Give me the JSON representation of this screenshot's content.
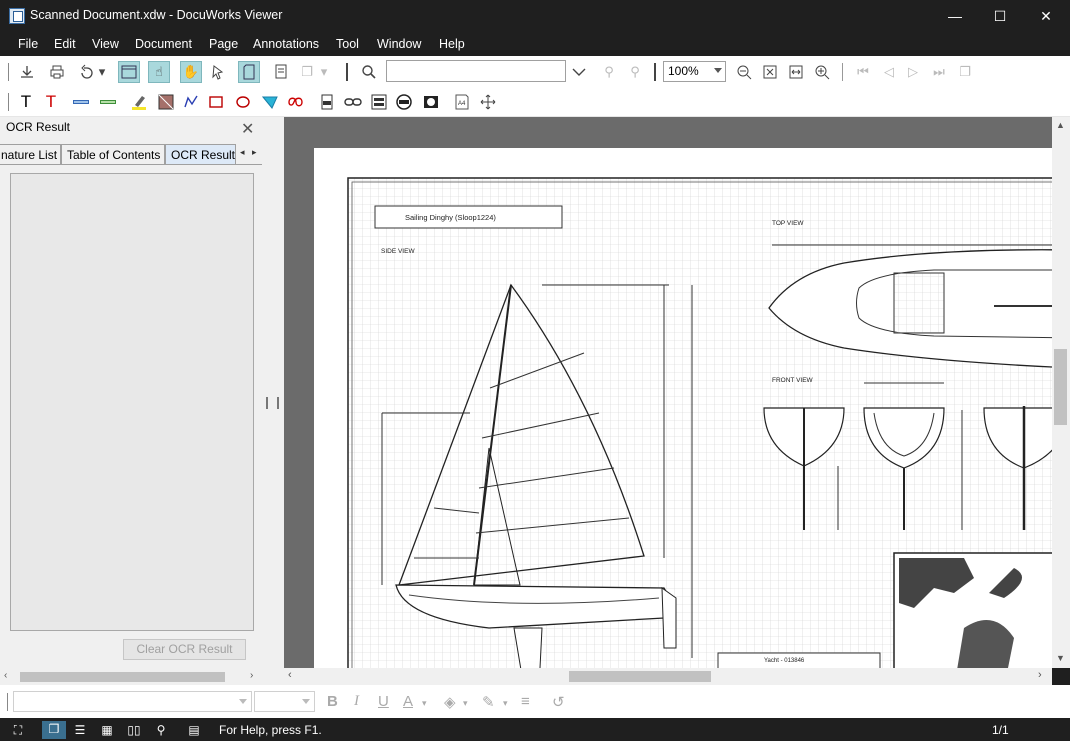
{
  "window": {
    "title": "Scanned Document.xdw - DocuWorks Viewer",
    "controls": {
      "minimize": "—",
      "maximize": "☐",
      "close": "✕"
    }
  },
  "menu": [
    "File",
    "Edit",
    "View",
    "Document",
    "Page",
    "Annotations",
    "Tool",
    "Window",
    "Help"
  ],
  "toolbar": {
    "search": {
      "value": "",
      "placeholder": ""
    },
    "zoom": "100%"
  },
  "panel": {
    "title": "OCR Result",
    "tabs": [
      "nature List",
      "Table of Contents",
      "OCR Result"
    ],
    "active_tab": "OCR Result",
    "clear_button": "Clear OCR Result"
  },
  "document": {
    "blueprint_title": "Sailing Dinghy (Sloop1224)",
    "side_view_label": "SIDE VIEW",
    "top_view_label": "TOP VIEW",
    "front_view_label": "FRONT VIEW",
    "footer_label": "Yacht - 013846"
  },
  "status": {
    "help_text": "For Help, press F1.",
    "page": "1/1"
  },
  "colors": {
    "chrome_dark": "#1f1f1f",
    "toggle_active": "#a9d8dc",
    "viewer_bg": "#6b6b6b"
  }
}
